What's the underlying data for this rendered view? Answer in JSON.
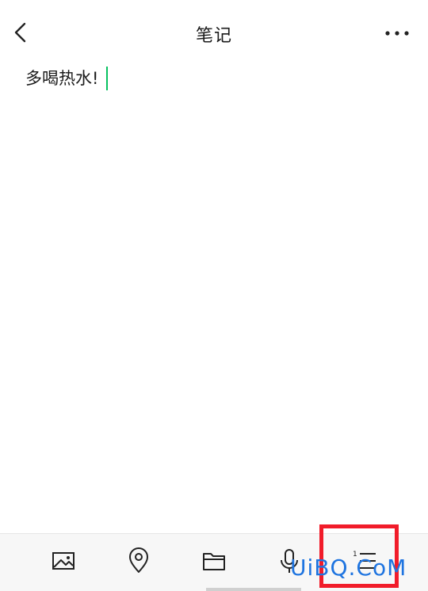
{
  "header": {
    "title": "笔记",
    "back_icon": "chevron-left-icon",
    "more_icon": "more-horizontal-icon"
  },
  "editor": {
    "content": "多喝热水!",
    "caret_color": "#07c160"
  },
  "toolbar": {
    "items": [
      {
        "name": "image",
        "icon": "image-icon"
      },
      {
        "name": "location",
        "icon": "location-pin-icon"
      },
      {
        "name": "folder",
        "icon": "folder-icon"
      },
      {
        "name": "voice",
        "icon": "microphone-icon"
      },
      {
        "name": "numbered-list",
        "icon": "numbered-list-icon"
      }
    ]
  },
  "annotation": {
    "highlight_color": "#f11c2a"
  },
  "watermark": {
    "text": "UiBQ.CoM",
    "color": "#1e74e0"
  }
}
